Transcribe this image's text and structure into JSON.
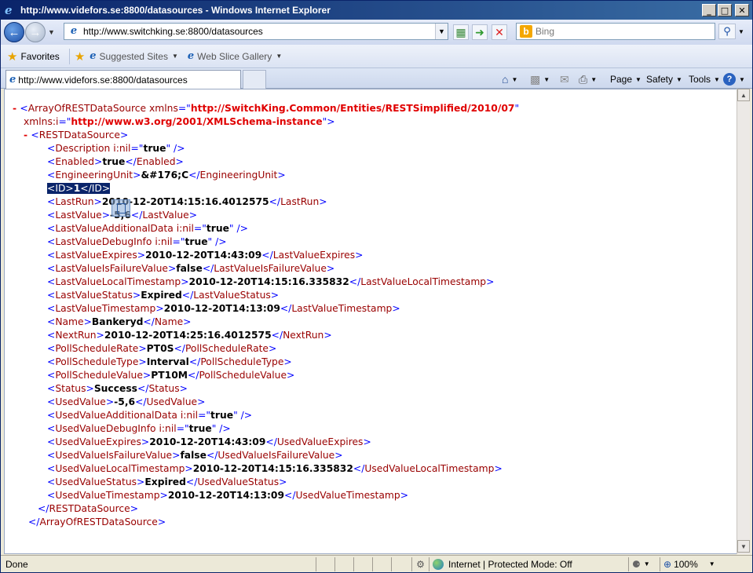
{
  "window": {
    "title": "http://www.videfors.se:8800/datasources - Windows Internet Explorer",
    "min_label": "_",
    "max_label": "□",
    "close_label": "✕"
  },
  "navbar": {
    "address": "http://www.switchking.se:8800/datasources",
    "search_placeholder": "Bing",
    "bing_glyph": "b"
  },
  "favorites": {
    "favorites_label": "Favorites",
    "links": [
      {
        "label": "Suggested Sites"
      },
      {
        "label": "Web Slice Gallery"
      }
    ]
  },
  "tab": {
    "label": "http://www.videfors.se:8800/datasources"
  },
  "commands": {
    "page": "Page",
    "safety": "Safety",
    "tools": "Tools"
  },
  "xml": {
    "root_tag": "ArrayOfRESTDataSource",
    "xmlns_attr": "xmlns",
    "xmlns_value": "http://SwitchKing.Common/Entities/RESTSimplified/2010/07",
    "xmlnsi_attr": "xmlns:i",
    "xmlnsi_value": "http://www.w3.org/2001/XMLSchema-instance",
    "child_tag": "RESTDataSource",
    "nil_attr": "i:nil",
    "nil_value": "true",
    "elements": [
      {
        "tag": "Description",
        "nil": true
      },
      {
        "tag": "Enabled",
        "value": "true"
      },
      {
        "tag": "EngineeringUnit",
        "value": "&#176;C"
      },
      {
        "tag": "ID",
        "value": "1",
        "selected": true
      },
      {
        "tag": "LastRun",
        "value": "2010-12-20T14:15:16.4012575"
      },
      {
        "tag": "LastValue",
        "value": "-5,6"
      },
      {
        "tag": "LastValueAdditionalData",
        "nil": true
      },
      {
        "tag": "LastValueDebugInfo",
        "nil": true
      },
      {
        "tag": "LastValueExpires",
        "value": "2010-12-20T14:43:09"
      },
      {
        "tag": "LastValueIsFailureValue",
        "value": "false"
      },
      {
        "tag": "LastValueLocalTimestamp",
        "value": "2010-12-20T14:15:16.335832"
      },
      {
        "tag": "LastValueStatus",
        "value": "Expired"
      },
      {
        "tag": "LastValueTimestamp",
        "value": "2010-12-20T14:13:09"
      },
      {
        "tag": "Name",
        "value": "Bankeryd"
      },
      {
        "tag": "NextRun",
        "value": "2010-12-20T14:25:16.4012575"
      },
      {
        "tag": "PollScheduleRate",
        "value": "PT0S"
      },
      {
        "tag": "PollScheduleType",
        "value": "Interval"
      },
      {
        "tag": "PollScheduleValue",
        "value": "PT10M"
      },
      {
        "tag": "Status",
        "value": "Success"
      },
      {
        "tag": "UsedValue",
        "value": "-5,6"
      },
      {
        "tag": "UsedValueAdditionalData",
        "nil": true
      },
      {
        "tag": "UsedValueDebugInfo",
        "nil": true
      },
      {
        "tag": "UsedValueExpires",
        "value": "2010-12-20T14:43:09"
      },
      {
        "tag": "UsedValueIsFailureValue",
        "value": "false"
      },
      {
        "tag": "UsedValueLocalTimestamp",
        "value": "2010-12-20T14:15:16.335832"
      },
      {
        "tag": "UsedValueStatus",
        "value": "Expired"
      },
      {
        "tag": "UsedValueTimestamp",
        "value": "2010-12-20T14:13:09"
      }
    ]
  },
  "status": {
    "left": "Done",
    "zone": "Internet | Protected Mode: Off",
    "zoom": "100%"
  }
}
